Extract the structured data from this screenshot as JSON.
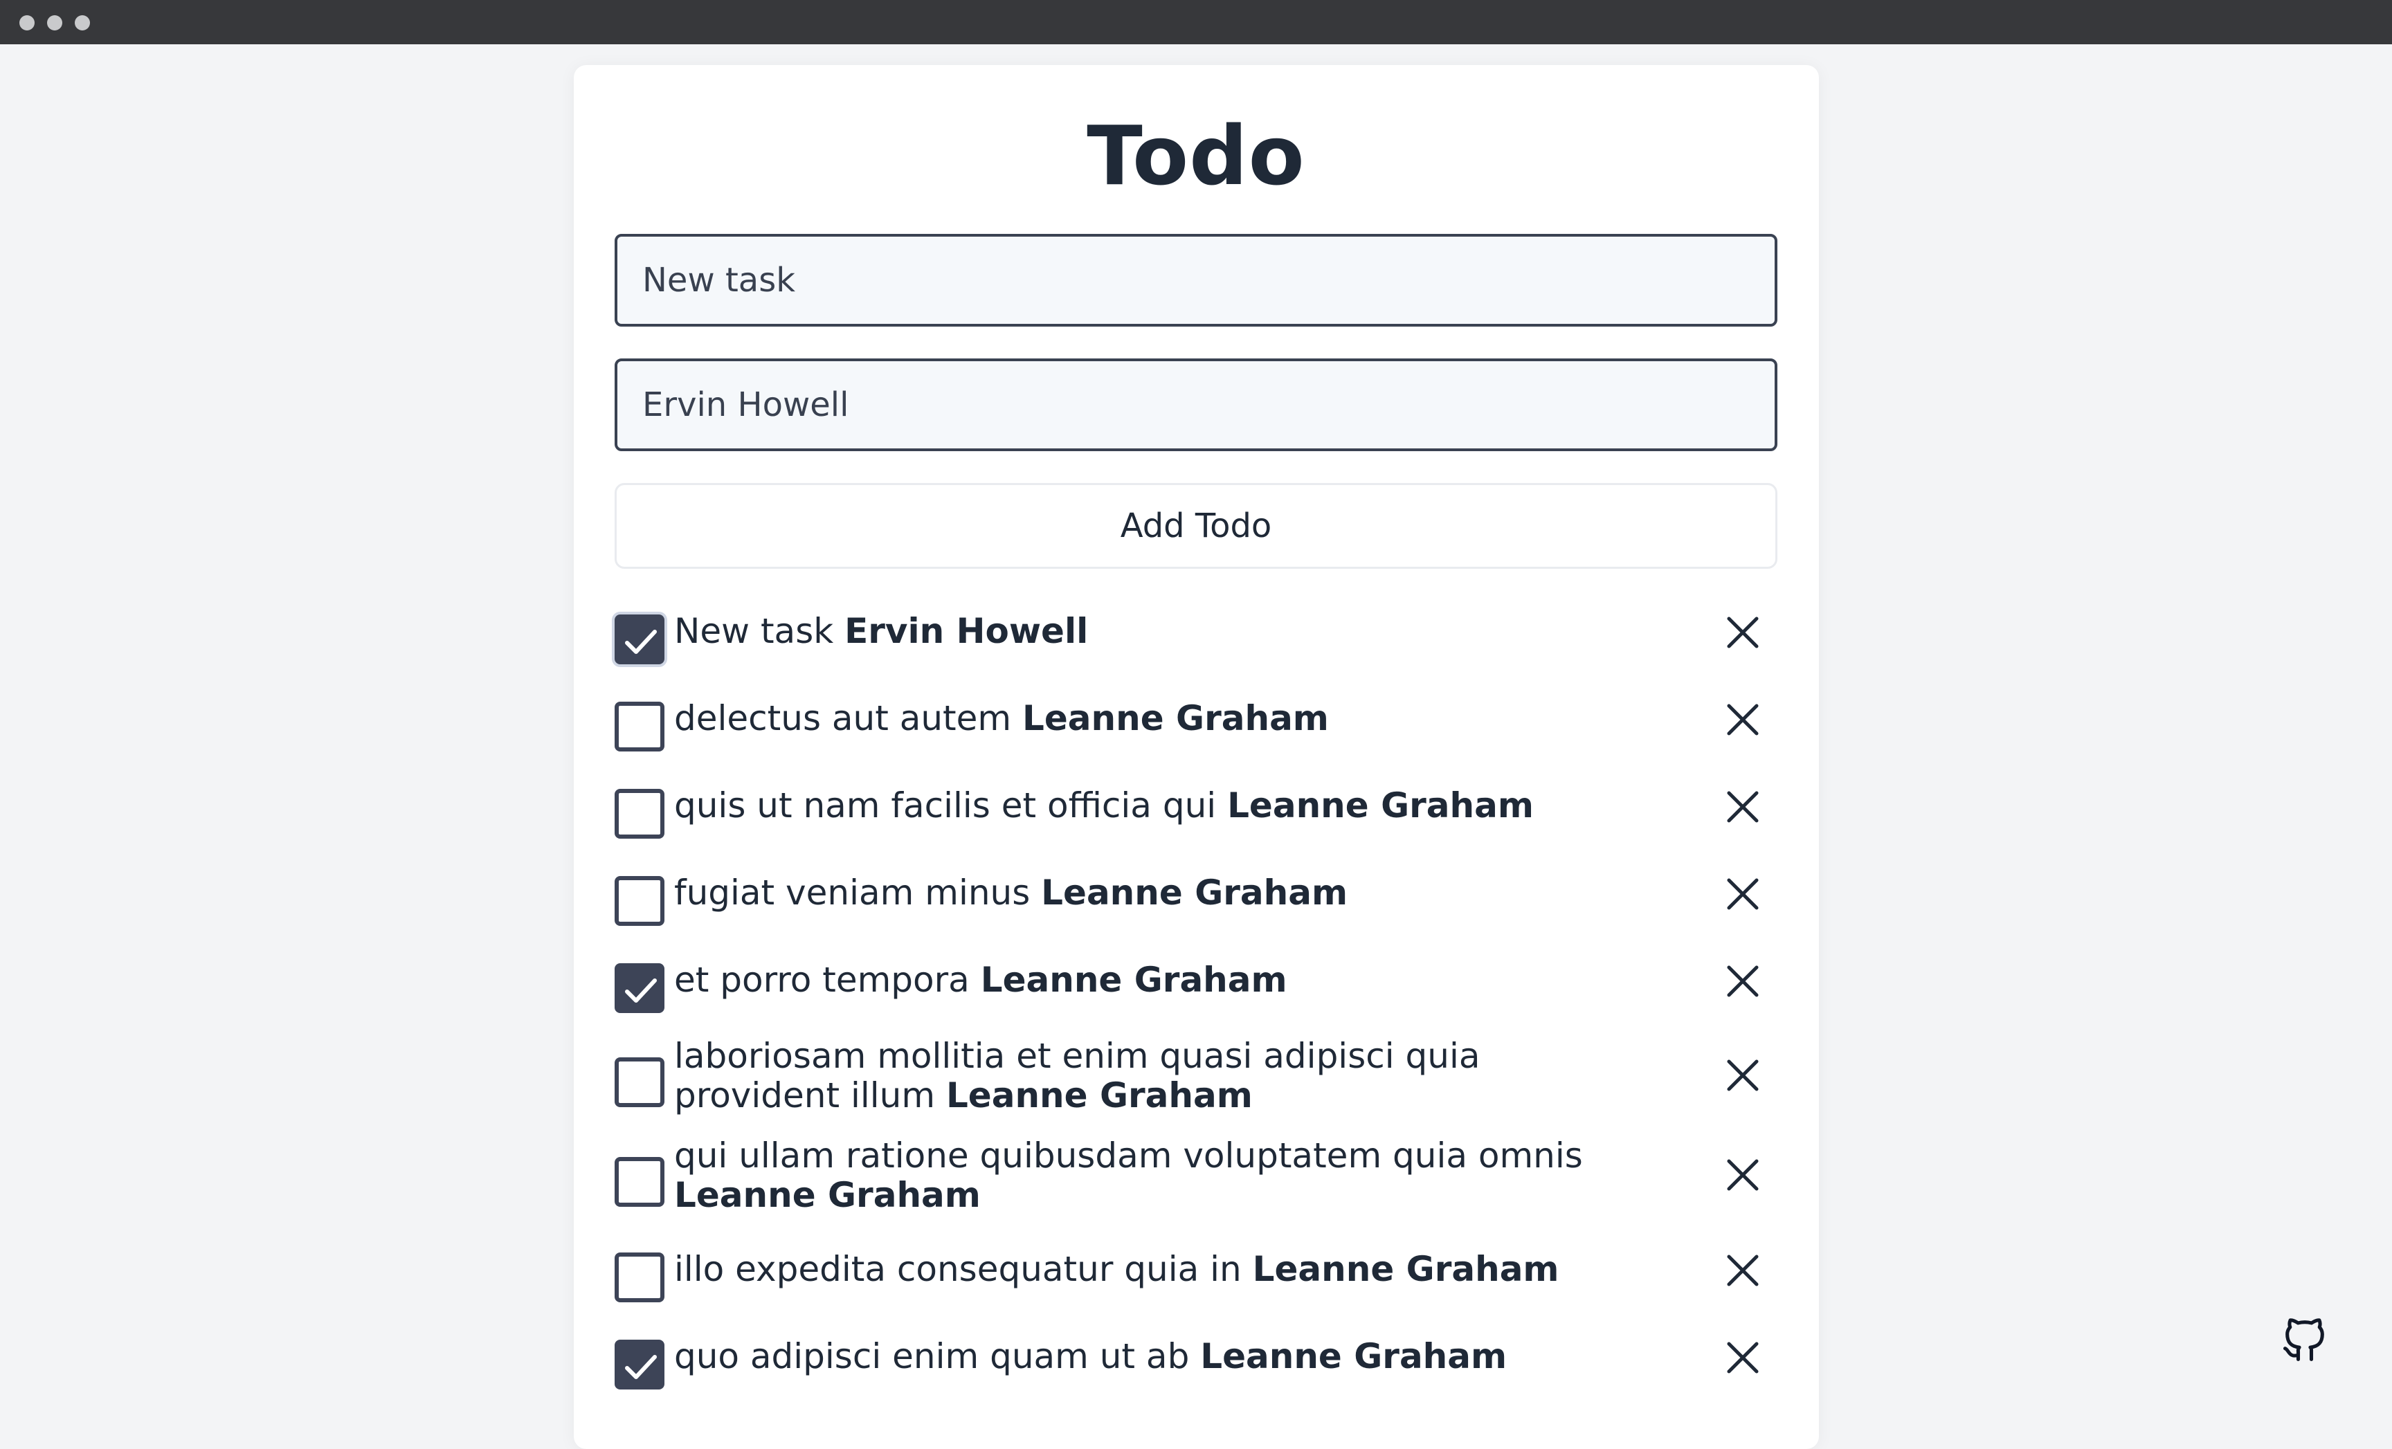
{
  "window": {
    "controls": [
      "close",
      "minimize",
      "maximize"
    ]
  },
  "app": {
    "title": "Todo"
  },
  "form": {
    "task_value": "New task",
    "assignee_value": "Ervin Howell",
    "add_label": "Add Todo"
  },
  "todos": [
    {
      "task": "New task",
      "assignee": "Ervin Howell",
      "completed": true
    },
    {
      "task": "delectus aut autem",
      "assignee": "Leanne Graham",
      "completed": false
    },
    {
      "task": "quis ut nam facilis et officia qui",
      "assignee": "Leanne Graham",
      "completed": false
    },
    {
      "task": "fugiat veniam minus",
      "assignee": "Leanne Graham",
      "completed": false
    },
    {
      "task": "et porro tempora",
      "assignee": "Leanne Graham",
      "completed": true
    },
    {
      "task": "laboriosam mollitia et enim quasi adipisci quia provident illum",
      "assignee": "Leanne Graham",
      "completed": false
    },
    {
      "task": "qui ullam ratione quibusdam voluptatem quia omnis",
      "assignee": "Leanne Graham",
      "completed": false
    },
    {
      "task": "illo expedita consequatur quia in",
      "assignee": "Leanne Graham",
      "completed": false
    },
    {
      "task": "quo adipisci enim quam ut ab",
      "assignee": "Leanne Graham",
      "completed": true
    }
  ],
  "icons": {
    "check": "check-icon",
    "delete": "close-icon",
    "github": "github-icon"
  },
  "colors": {
    "checkbox_accent": "#3d4457",
    "title_text": "#1f2937",
    "page_background": "#f3f4f6"
  }
}
